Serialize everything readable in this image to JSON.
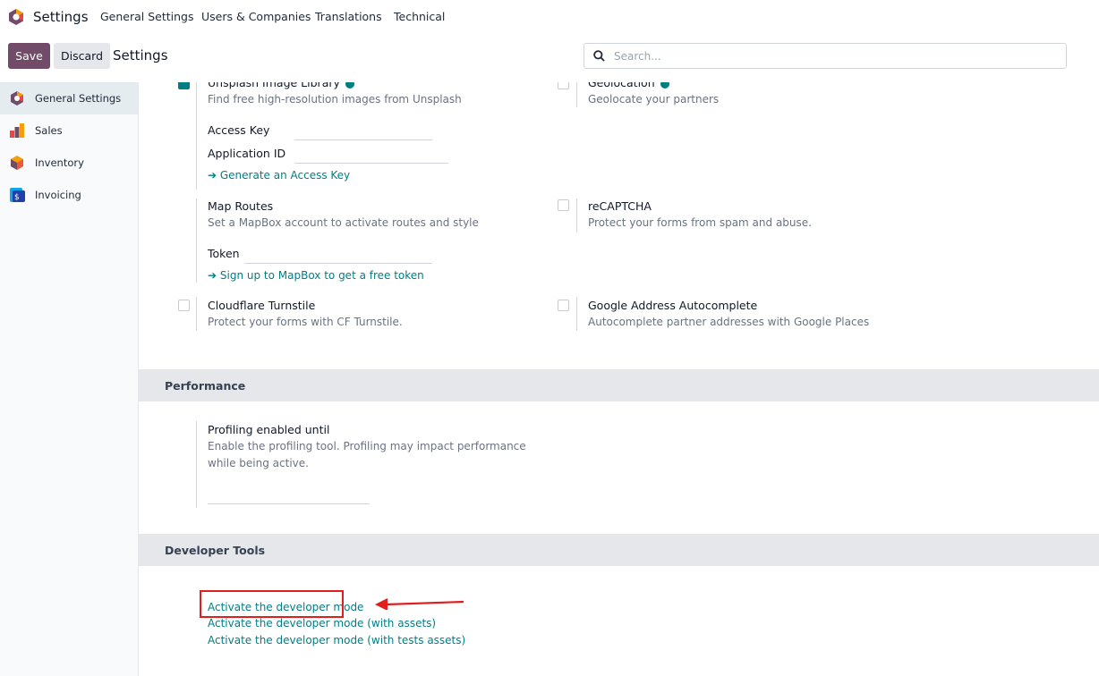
{
  "app": {
    "name": "Settings"
  },
  "topnav": [
    "General Settings",
    "Users & Companies",
    "Translations",
    "Technical"
  ],
  "control": {
    "save": "Save",
    "discard": "Discard",
    "breadcrumb": "Settings",
    "search_placeholder": "Search..."
  },
  "sidebar": {
    "items": [
      {
        "label": "General Settings",
        "icon": "settings-hex-icon",
        "active": true
      },
      {
        "label": "Sales",
        "icon": "sales-chart-icon"
      },
      {
        "label": "Inventory",
        "icon": "inventory-box-icon"
      },
      {
        "label": "Invoicing",
        "icon": "invoicing-doc-icon"
      }
    ]
  },
  "integrations": {
    "unsplash": {
      "title": "Unsplash Image Library",
      "desc": "Find free high-resolution images from Unsplash",
      "checked": true,
      "access_key_label": "Access Key",
      "app_id_label": "Application ID",
      "link": "➔ Generate an Access Key"
    },
    "geolocation": {
      "title": "Geolocation",
      "desc": "Geolocate your partners",
      "checked": false
    },
    "map_routes": {
      "title": "Map Routes",
      "desc": "Set a MapBox account to activate routes and style",
      "token_label": "Token",
      "link": "➔ Sign up to MapBox to get a free token"
    },
    "recaptcha": {
      "title": "reCAPTCHA",
      "desc": "Protect your forms from spam and abuse.",
      "checked": false
    },
    "turnstile": {
      "title": "Cloudflare Turnstile",
      "desc": "Protect your forms with CF Turnstile.",
      "checked": false
    },
    "google_autocomplete": {
      "title": "Google Address Autocomplete",
      "desc": "Autocomplete partner addresses with Google Places",
      "checked": false
    }
  },
  "performance": {
    "heading": "Performance",
    "title": "Profiling enabled until",
    "desc_line1": "Enable the profiling tool. Profiling may impact performance",
    "desc_line2": "while being active."
  },
  "developer": {
    "heading": "Developer Tools",
    "links": [
      "Activate the developer mode",
      "Activate the developer mode (with assets)",
      "Activate the developer mode (with tests assets)"
    ]
  },
  "colors": {
    "brand": "#714b67",
    "link": "#017e84",
    "annotation": "#e11d1d"
  }
}
